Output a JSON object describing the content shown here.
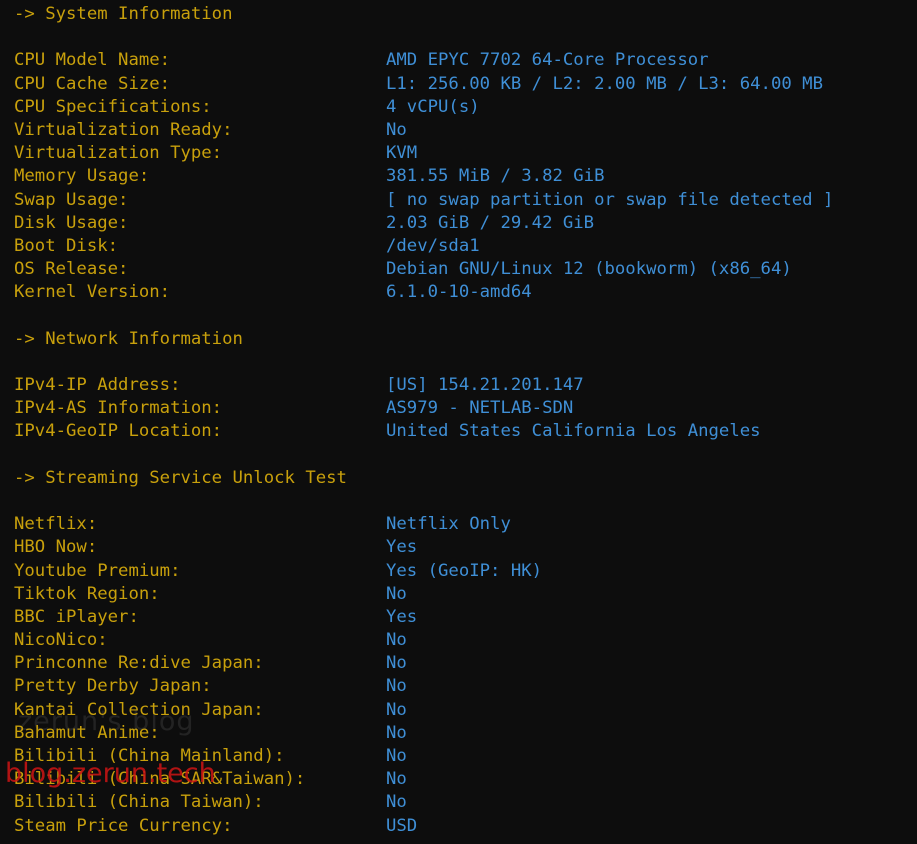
{
  "terminal": {
    "background_color": "#0d0d0d",
    "label_color": "#c8a00c",
    "value_color": "#3f8fd6",
    "heading_color": "#c8a00c"
  },
  "sections": [
    {
      "heading": "-> System Information",
      "rows": [
        {
          "label": "CPU Model Name:",
          "value": "AMD EPYC 7702 64-Core Processor"
        },
        {
          "label": "CPU Cache Size:",
          "value": "L1: 256.00 KB / L2: 2.00 MB / L3: 64.00 MB"
        },
        {
          "label": "CPU Specifications:",
          "value": "4 vCPU(s)"
        },
        {
          "label": "Virtualization Ready:",
          "value": "No"
        },
        {
          "label": "Virtualization Type:",
          "value": "KVM"
        },
        {
          "label": "Memory Usage:",
          "value": "381.55 MiB / 3.82 GiB"
        },
        {
          "label": "Swap Usage:",
          "value": "[ no swap partition or swap file detected ]"
        },
        {
          "label": "Disk Usage:",
          "value": "2.03 GiB / 29.42 GiB"
        },
        {
          "label": "Boot Disk:",
          "value": "/dev/sda1"
        },
        {
          "label": "OS Release:",
          "value": "Debian GNU/Linux 12 (bookworm) (x86_64)"
        },
        {
          "label": "Kernel Version:",
          "value": "6.1.0-10-amd64"
        }
      ]
    },
    {
      "heading": "-> Network Information",
      "rows": [
        {
          "label": "IPv4-IP Address:",
          "value": "[US] 154.21.201.147"
        },
        {
          "label": "IPv4-AS Information:",
          "value": "AS979 - NETLAB-SDN"
        },
        {
          "label": "IPv4-GeoIP Location:",
          "value": "United States California Los Angeles"
        }
      ]
    },
    {
      "heading": "-> Streaming Service Unlock Test",
      "rows": [
        {
          "label": "Netflix:",
          "value": "Netflix Only"
        },
        {
          "label": "HBO Now:",
          "value": "Yes"
        },
        {
          "label": "Youtube Premium:",
          "value": "Yes (GeoIP: HK)"
        },
        {
          "label": "Tiktok Region:",
          "value": "No"
        },
        {
          "label": "BBC iPlayer:",
          "value": "Yes"
        },
        {
          "label": "NicoNico:",
          "value": "No"
        },
        {
          "label": "Princonne Re:dive Japan:",
          "value": "No"
        },
        {
          "label": "Pretty Derby Japan:",
          "value": "No"
        },
        {
          "label": "Kantai Collection Japan:",
          "value": "No"
        },
        {
          "label": "Bahamut Anime:",
          "value": "No"
        },
        {
          "label": "Bilibili (China Mainland):",
          "value": "No"
        },
        {
          "label": "Bilibili (China SAR&Taiwan):",
          "value": "No"
        },
        {
          "label": "Bilibili (China Taiwan):",
          "value": "No"
        },
        {
          "label": "Steam Price Currency:",
          "value": "USD"
        }
      ]
    }
  ],
  "watermarks": {
    "grey_text": "zerun's blog",
    "red_text": "blog.zerun.tech",
    "grey_color": "#969696",
    "red_color": "#c81414"
  }
}
